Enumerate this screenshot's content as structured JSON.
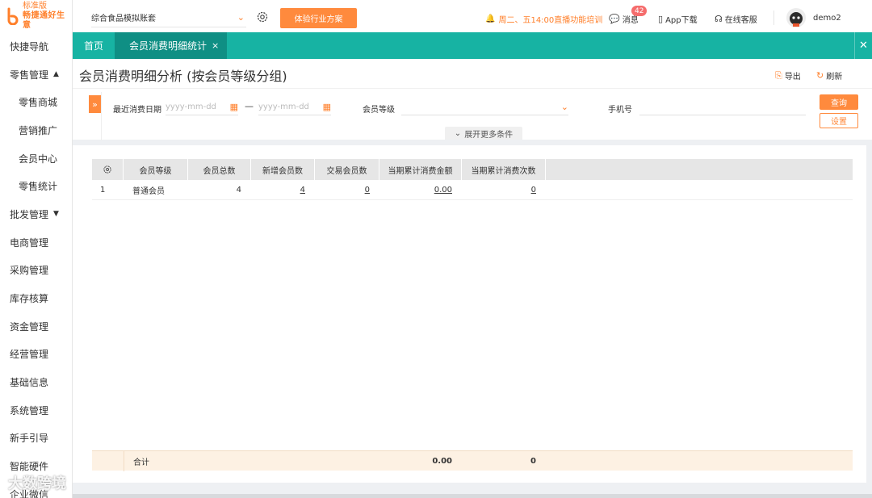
{
  "brand": {
    "edition": "标准版",
    "slogan": "畅捷通好生意",
    "accent": "#ff7f2a"
  },
  "sidebar": {
    "items": [
      {
        "label": "快捷导航",
        "type": "top"
      },
      {
        "label": "零售管理",
        "type": "top",
        "caret": "▲"
      },
      {
        "label": "零售商城",
        "type": "sub"
      },
      {
        "label": "营销推广",
        "type": "sub"
      },
      {
        "label": "会员中心",
        "type": "sub"
      },
      {
        "label": "零售统计",
        "type": "sub"
      },
      {
        "label": "批发管理",
        "type": "top",
        "caret": "▼"
      },
      {
        "label": "电商管理",
        "type": "top"
      },
      {
        "label": "采购管理",
        "type": "top"
      },
      {
        "label": "库存核算",
        "type": "top"
      },
      {
        "label": "资金管理",
        "type": "top"
      },
      {
        "label": "经营管理",
        "type": "top"
      },
      {
        "label": "基础信息",
        "type": "top"
      },
      {
        "label": "系统管理",
        "type": "top"
      },
      {
        "label": "新手引导",
        "type": "top"
      },
      {
        "label": "智能硬件",
        "type": "top"
      },
      {
        "label": "企业微信",
        "type": "top"
      }
    ]
  },
  "topbar": {
    "account": "综合食品模拟账套",
    "trial_button": "体验行业方案",
    "notice": "周二、五14:00直播功能培训",
    "messages_label": "消息",
    "messages_count": "42",
    "app_label": "App下载",
    "service_label": "在线客服",
    "username": "demo2"
  },
  "tabs": {
    "home": "首页",
    "active": "会员消费明细统计",
    "close_symbol": "×"
  },
  "page": {
    "title": "会员消费明细分析 (按会员等级分组)",
    "export_label": "导出",
    "refresh_label": "刷新"
  },
  "filter": {
    "date_label": "最近消费日期",
    "date_from_placeholder": "yyyy-mm-dd",
    "date_to_placeholder": "yyyy-mm-dd",
    "date_sep": "—",
    "level_label": "会员等级",
    "level_value": "",
    "phone_label": "手机号",
    "phone_value": "",
    "query_button": "查询",
    "setting_button": "设置",
    "more_conditions": "展开更多条件"
  },
  "table": {
    "columns": [
      "会员等级",
      "会员总数",
      "新增会员数",
      "交易会员数",
      "当期累计消费金额",
      "当期累计消费次数"
    ],
    "rows": [
      {
        "index": "1",
        "level": "普通会员",
        "total": "4",
        "new": "4",
        "trading": "0",
        "amount": "0.00",
        "times": "0"
      }
    ],
    "footer": {
      "label": "合计",
      "amount": "0.00",
      "times": "0"
    }
  },
  "watermark": "大数跨境"
}
